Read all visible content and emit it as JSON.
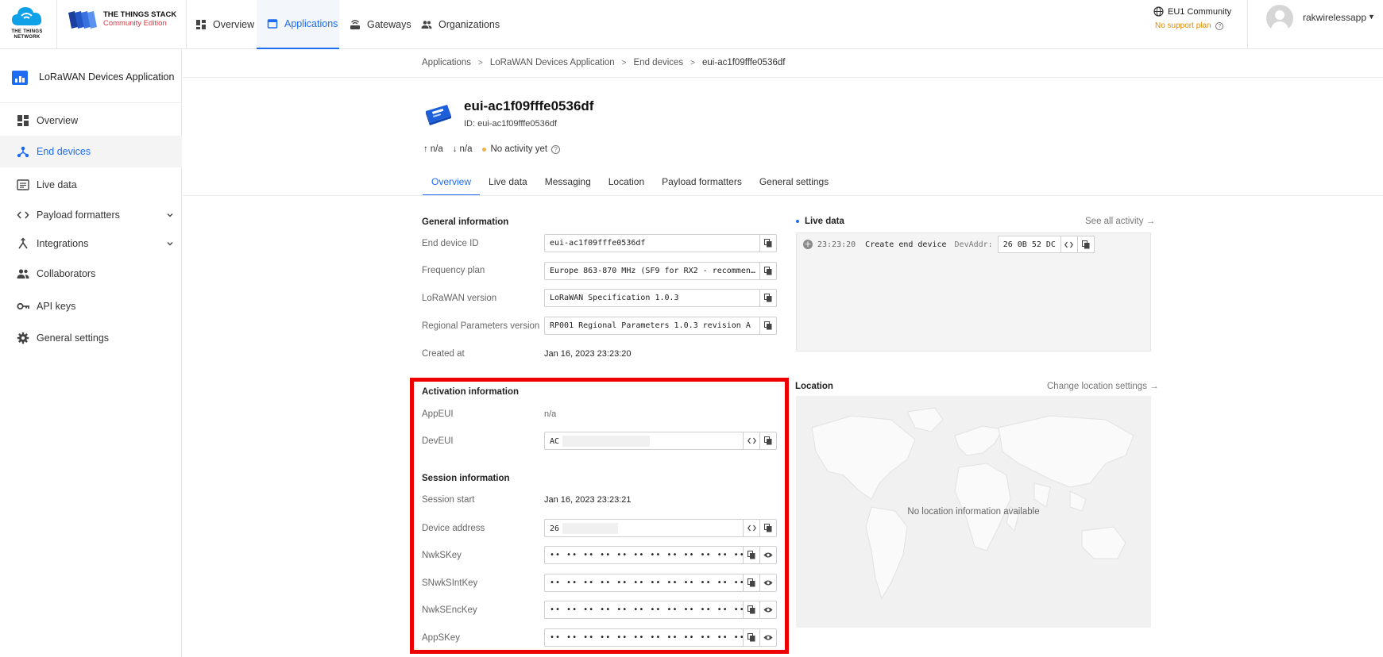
{
  "brand": {
    "ttn_logo_text": "THE THINGS\nNETWORK",
    "stack_title": "THE THINGS STACK",
    "stack_edition": "Community Edition"
  },
  "topnav": {
    "items": [
      {
        "label": "Overview",
        "icon": "dashboard-icon"
      },
      {
        "label": "Applications",
        "icon": "application-icon",
        "active": true
      },
      {
        "label": "Gateways",
        "icon": "router-icon"
      },
      {
        "label": "Organizations",
        "icon": "people-icon"
      }
    ],
    "cluster": "EU1 Community",
    "support_plan": "No support plan",
    "username": "rakwirelessapp"
  },
  "sidebar": {
    "app_title": "LoRaWAN Devices Application",
    "items": [
      {
        "label": "Overview",
        "icon": "dashboard-icon"
      },
      {
        "label": "End devices",
        "icon": "device-hub-icon",
        "active": true
      },
      {
        "label": "Live data",
        "icon": "list-icon"
      },
      {
        "label": "Payload formatters",
        "icon": "code-icon",
        "expandable": true
      },
      {
        "label": "Integrations",
        "icon": "integration-icon",
        "expandable": true
      },
      {
        "label": "Collaborators",
        "icon": "people-icon"
      },
      {
        "label": "API keys",
        "icon": "key-icon"
      },
      {
        "label": "General settings",
        "icon": "gear-icon"
      }
    ]
  },
  "breadcrumb": [
    "Applications",
    "LoRaWAN Devices Application",
    "End devices",
    "eui-ac1f09fffe0536df"
  ],
  "device": {
    "title": "eui-ac1f09fffe0536df",
    "id_line": "ID: eui-ac1f09fffe0536df",
    "uplink": "n/a",
    "downlink": "n/a",
    "activity": "No activity yet"
  },
  "tabs": [
    "Overview",
    "Live data",
    "Messaging",
    "Location",
    "Payload formatters",
    "General settings"
  ],
  "general": {
    "title": "General information",
    "end_device_id_label": "End device ID",
    "end_device_id": "eui-ac1f09fffe0536df",
    "frequency_plan_label": "Frequency plan",
    "frequency_plan": "Europe 863-870 MHz (SF9 for RX2 - recommen…",
    "lorawan_version_label": "LoRaWAN version",
    "lorawan_version": "LoRaWAN Specification 1.0.3",
    "regional_params_label": "Regional Parameters version",
    "regional_params": "RP001 Regional Parameters 1.0.3 revision A",
    "created_at_label": "Created at",
    "created_at": "Jan 16, 2023 23:23:20"
  },
  "activation": {
    "title": "Activation information",
    "appeui_label": "AppEUI",
    "appeui": "n/a",
    "deveui_label": "DevEUI",
    "deveui": "AC"
  },
  "session": {
    "title": "Session information",
    "start_label": "Session start",
    "start": "Jan 16, 2023 23:23:21",
    "device_address_label": "Device address",
    "device_address": "26",
    "nwkskey_label": "NwkSKey",
    "snwksintkey_label": "SNwkSIntKey",
    "nwksenckey_label": "NwkSEncKey",
    "appskey_label": "AppSKey",
    "masked_value": "•• •• •• •• •• •• •• •• •• •• •• •• •• •• •• ••"
  },
  "live_data": {
    "title": "Live data",
    "see_all": "See all activity →",
    "event_time": "23:23:20",
    "event_text": "Create end device",
    "devaddr_label": "DevAddr:",
    "devaddr": "26 0B 52 DC"
  },
  "location": {
    "title": "Location",
    "change": "Change location settings →",
    "empty": "No location information available"
  },
  "colors": {
    "accent": "#1d6cf2",
    "highlight": "#ee0000",
    "support": "#e58a00"
  }
}
